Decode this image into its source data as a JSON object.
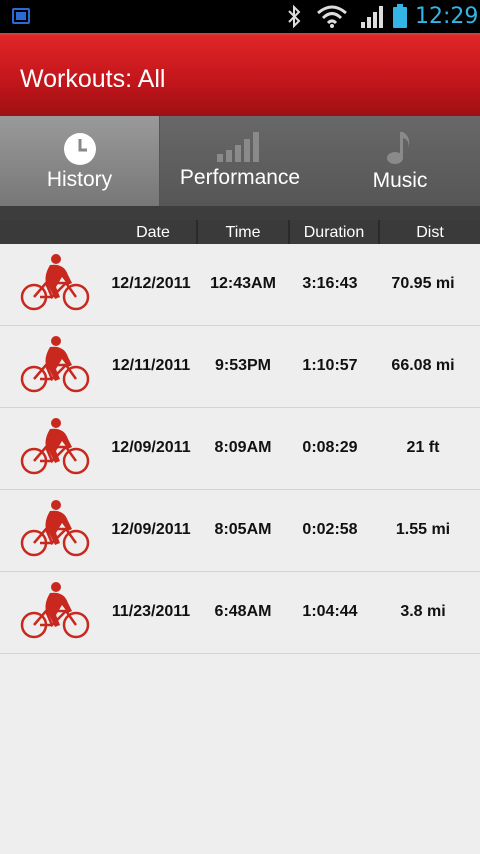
{
  "status_bar": {
    "time": "12:29",
    "icons": [
      "notification-icon",
      "bluetooth-icon",
      "wifi-icon",
      "signal-icon",
      "battery-icon"
    ]
  },
  "title_bar": {
    "title": "Workouts: All"
  },
  "tabs": [
    {
      "label": "History",
      "icon": "clock-icon",
      "selected": true
    },
    {
      "label": "Performance",
      "icon": "bar-signal-icon",
      "selected": false
    },
    {
      "label": "Music",
      "icon": "music-note-icon",
      "selected": false
    }
  ],
  "columns": {
    "date": "Date",
    "time": "Time",
    "duration": "Duration",
    "dist": "Dist"
  },
  "workouts": [
    {
      "icon": "cyclist-icon",
      "date": "12/12/2011",
      "time": "12:43AM",
      "duration": "3:16:43",
      "dist": "70.95 mi"
    },
    {
      "icon": "cyclist-icon",
      "date": "12/11/2011",
      "time": "9:53PM",
      "duration": "1:10:57",
      "dist": "66.08 mi"
    },
    {
      "icon": "cyclist-icon",
      "date": "12/09/2011",
      "time": "8:09AM",
      "duration": "0:08:29",
      "dist": "21 ft"
    },
    {
      "icon": "cyclist-icon",
      "date": "12/09/2011",
      "time": "8:05AM",
      "duration": "0:02:58",
      "dist": "1.55 mi"
    },
    {
      "icon": "cyclist-icon",
      "date": "11/23/2011",
      "time": "6:48AM",
      "duration": "1:04:44",
      "dist": "3.8 mi"
    }
  ],
  "colors": {
    "accent_red": "#c4161c",
    "status_blue": "#33b5e5",
    "icon_red": "#c8281e"
  }
}
